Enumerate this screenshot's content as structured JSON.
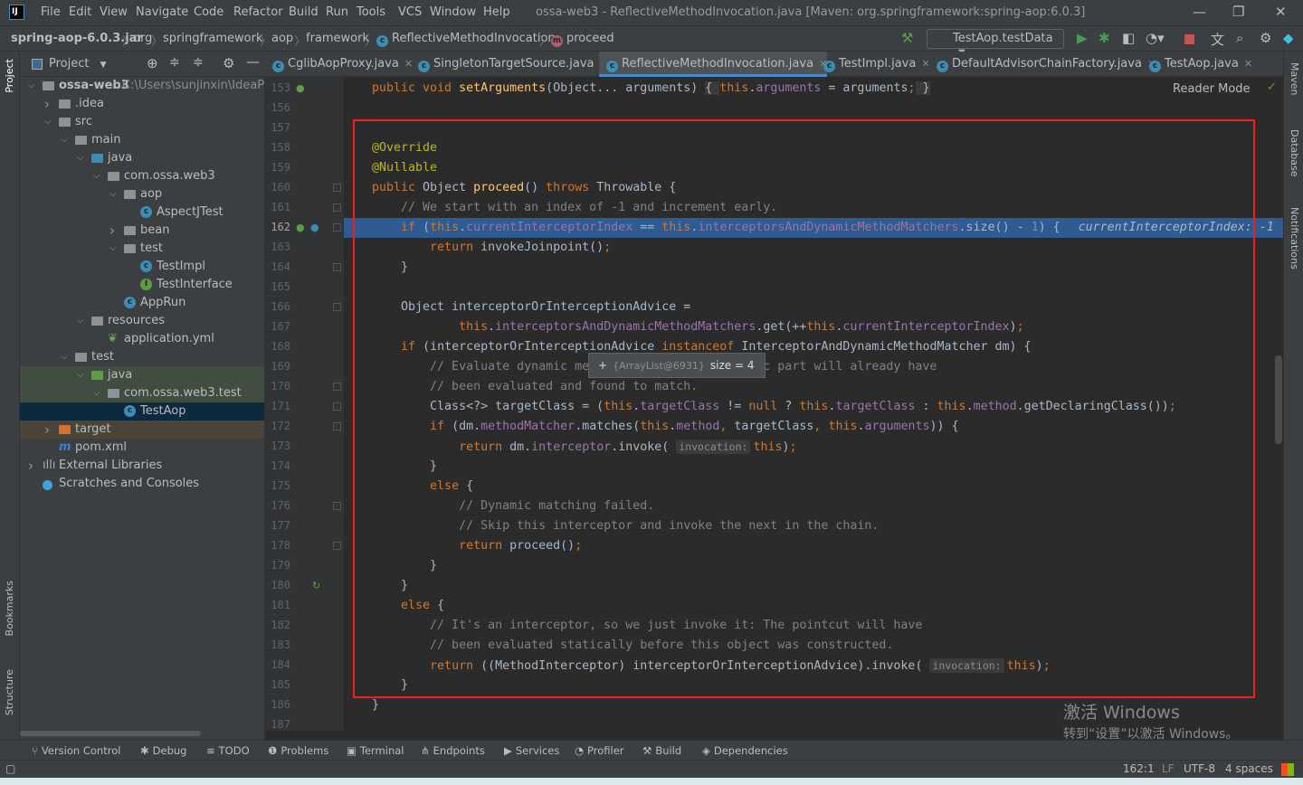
{
  "window": {
    "title": "ossa-web3 - ReflectiveMethodInvocation.java [Maven: org.springframework:spring-aop:6.0.3]",
    "logo": "IJ",
    "minimize": "—",
    "restore": "❐",
    "close": "✕"
  },
  "menu": [
    "File",
    "Edit",
    "View",
    "Navigate",
    "Code",
    "Refactor",
    "Build",
    "Run",
    "Tools",
    "VCS",
    "Window",
    "Help"
  ],
  "breadcrumb": [
    "spring-aop-6.0.3.jar",
    "org",
    "springframework",
    "aop",
    "framework",
    "ReflectiveMethodInvocation",
    "proceed"
  ],
  "toolbar": {
    "run_config": "TestAop.testData",
    "icons": [
      "build-hammer-icon",
      "run-icon",
      "debug-icon",
      "coverage-icon",
      "profile-icon",
      "stop-icon",
      "translate-icon",
      "search-icon",
      "settings-icon",
      "toolbox-icon"
    ]
  },
  "project_panel": {
    "title": "Project",
    "tree": [
      {
        "label": "ossa-web3",
        "path": "C:\\Users\\sunjinxin\\IdeaProj",
        "level": 0,
        "arrow": "open",
        "icon": "module"
      },
      {
        "label": ".idea",
        "level": 1,
        "arrow": "closed",
        "icon": "folder"
      },
      {
        "label": "src",
        "level": 1,
        "arrow": "open",
        "icon": "folder"
      },
      {
        "label": "main",
        "level": 2,
        "arrow": "open",
        "icon": "folder"
      },
      {
        "label": "java",
        "level": 3,
        "arrow": "open",
        "icon": "src-folder"
      },
      {
        "label": "com.ossa.web3",
        "level": 4,
        "arrow": "open",
        "icon": "package"
      },
      {
        "label": "aop",
        "level": 5,
        "arrow": "open",
        "icon": "package"
      },
      {
        "label": "AspectJTest",
        "level": 6,
        "icon": "class"
      },
      {
        "label": "bean",
        "level": 5,
        "arrow": "closed",
        "icon": "package"
      },
      {
        "label": "test",
        "level": 5,
        "arrow": "open",
        "icon": "package"
      },
      {
        "label": "TestImpl",
        "level": 6,
        "icon": "class"
      },
      {
        "label": "TestInterface",
        "level": 6,
        "icon": "interface"
      },
      {
        "label": "AppRun",
        "level": 5,
        "icon": "class"
      },
      {
        "label": "resources",
        "level": 3,
        "arrow": "open",
        "icon": "folder"
      },
      {
        "label": "application.yml",
        "level": 4,
        "icon": "yml"
      },
      {
        "label": "test",
        "level": 2,
        "arrow": "open",
        "icon": "folder"
      },
      {
        "label": "java",
        "level": 3,
        "arrow": "open",
        "icon": "test-folder",
        "state": "highlighted"
      },
      {
        "label": "com.ossa.web3.test",
        "level": 4,
        "arrow": "open",
        "icon": "package",
        "state": "highlighted"
      },
      {
        "label": "TestAop",
        "level": 5,
        "icon": "class",
        "state": "selected"
      },
      {
        "label": "target",
        "level": 1,
        "arrow": "closed",
        "icon": "excluded-folder",
        "state": "excluded"
      },
      {
        "label": "pom.xml",
        "level": 1,
        "icon": "maven"
      },
      {
        "label": "External Libraries",
        "level": 0,
        "arrow": "closed",
        "icon": "libraries"
      },
      {
        "label": "Scratches and Consoles",
        "level": 0,
        "icon": "scratches"
      }
    ]
  },
  "tabs": [
    {
      "label": "CglibAopProxy.java"
    },
    {
      "label": "SingletonTargetSource.java"
    },
    {
      "label": "ReflectiveMethodInvocation.java",
      "active": true
    },
    {
      "label": "TestImpl.java"
    },
    {
      "label": "DefaultAdvisorChainFactory.java"
    },
    {
      "label": "TestAop.java"
    }
  ],
  "editor": {
    "reader_mode": "Reader Mode",
    "current_line": 162,
    "lines": [
      {
        "n": 153,
        "t": [
          [
            "kw",
            "public void "
          ],
          [
            "fn",
            "setArguments"
          ],
          [
            "",
            "(Object... arguments) "
          ],
          [
            "hl",
            "{ "
          ],
          [
            "kw",
            "this"
          ],
          [
            "",
            "."
          ],
          [
            "fd",
            "arguments"
          ],
          [
            "",
            " = arguments"
          ],
          [
            "kw",
            ";"
          ],
          [
            "hl",
            " }"
          ]
        ]
      },
      {
        "n": 156,
        "t": []
      },
      {
        "n": 157,
        "t": []
      },
      {
        "n": 158,
        "t": [
          [
            "an",
            "@Override"
          ]
        ]
      },
      {
        "n": 159,
        "t": [
          [
            "an",
            "@Nullable"
          ]
        ]
      },
      {
        "n": 160,
        "t": [
          [
            "kw",
            "public "
          ],
          [
            "",
            "Object "
          ],
          [
            "fn",
            "proceed"
          ],
          [
            "",
            "() "
          ],
          [
            "kw",
            "throws "
          ],
          [
            "",
            "Throwable {"
          ]
        ]
      },
      {
        "n": 161,
        "t": [
          [
            "cm",
            "    // We start with an index of -1 and increment early."
          ]
        ]
      },
      {
        "n": 162,
        "t": [
          [
            "",
            "    "
          ],
          [
            "kw",
            "if "
          ],
          [
            "",
            "("
          ],
          [
            "kw",
            "this"
          ],
          [
            "",
            "."
          ],
          [
            "fd",
            "currentInterceptorIndex"
          ],
          [
            "",
            " == "
          ],
          [
            "kw",
            "this"
          ],
          [
            "",
            "."
          ],
          [
            "fd",
            "interceptorsAndDynamicMethodMatchers"
          ],
          [
            "",
            ".size() - "
          ],
          [
            "nm",
            "1"
          ],
          [
            "",
            ") {"
          ],
          [
            "ht2",
            "currentInterceptorIndex: -1"
          ]
        ]
      },
      {
        "n": 163,
        "t": [
          [
            "",
            "        "
          ],
          [
            "kw",
            "return "
          ],
          [
            "",
            "invokeJoinpoint()"
          ],
          [
            "kw",
            ";"
          ]
        ]
      },
      {
        "n": 164,
        "t": [
          [
            "",
            "    }"
          ]
        ]
      },
      {
        "n": 165,
        "t": []
      },
      {
        "n": 166,
        "t": [
          [
            "",
            "    Object interceptorOrInterceptionAdvice ="
          ]
        ]
      },
      {
        "n": 167,
        "t": [
          [
            "",
            "            "
          ],
          [
            "kw",
            "this"
          ],
          [
            "",
            "."
          ],
          [
            "fd",
            "interceptorsAndDynamicMethodMatchers"
          ],
          [
            "",
            ".get(++"
          ],
          [
            "kw",
            "this"
          ],
          [
            "",
            "."
          ],
          [
            "fd",
            "currentInterceptorIndex"
          ],
          [
            "",
            ")"
          ],
          [
            "kw",
            ";"
          ]
        ]
      },
      {
        "n": 168,
        "t": [
          [
            "",
            "    "
          ],
          [
            "kw",
            "if "
          ],
          [
            "",
            "(interceptorOrInterceptionAdvice "
          ],
          [
            "kw",
            "instanceof "
          ],
          [
            "",
            "InterceptorAndDynamicMethodMatcher dm) {"
          ]
        ]
      },
      {
        "n": 169,
        "t": [
          [
            "cm",
            "        // Evaluate dynamic method matcher here: static part will already have"
          ]
        ]
      },
      {
        "n": 170,
        "t": [
          [
            "cm",
            "        // been evaluated and found to match."
          ]
        ]
      },
      {
        "n": 171,
        "t": [
          [
            "",
            "        Class<?> targetClass = ("
          ],
          [
            "kw",
            "this"
          ],
          [
            "",
            "."
          ],
          [
            "fd",
            "targetClass"
          ],
          [
            "",
            " != "
          ],
          [
            "kw",
            "null"
          ],
          [
            "",
            " ? "
          ],
          [
            "kw",
            "this"
          ],
          [
            "",
            "."
          ],
          [
            "fd",
            "targetClass"
          ],
          [
            "",
            " : "
          ],
          [
            "kw",
            "this"
          ],
          [
            "",
            "."
          ],
          [
            "fd",
            "method"
          ],
          [
            "",
            ".getDeclaringClass())"
          ],
          [
            "kw",
            ";"
          ]
        ]
      },
      {
        "n": 172,
        "t": [
          [
            "",
            "        "
          ],
          [
            "kw",
            "if "
          ],
          [
            "",
            "(dm."
          ],
          [
            "fd",
            "methodMatcher"
          ],
          [
            "",
            ".matches("
          ],
          [
            "kw",
            "this"
          ],
          [
            "",
            "."
          ],
          [
            "fd",
            "method"
          ],
          [
            "kw",
            ", "
          ],
          [
            "",
            "targetClass"
          ],
          [
            "kw",
            ", "
          ],
          [
            "kw",
            "this"
          ],
          [
            "",
            "."
          ],
          [
            "fd",
            "arguments"
          ],
          [
            "",
            ")) {"
          ]
        ]
      },
      {
        "n": 173,
        "t": [
          [
            "",
            "            "
          ],
          [
            "kw",
            "return "
          ],
          [
            "",
            "dm."
          ],
          [
            "fd",
            "interceptor"
          ],
          [
            "",
            ".invoke( "
          ],
          [
            "ht",
            "invocation:"
          ],
          [
            "kw",
            "this"
          ],
          [
            "",
            ")"
          ],
          [
            "kw",
            ";"
          ]
        ]
      },
      {
        "n": 174,
        "t": [
          [
            "",
            "        }"
          ]
        ]
      },
      {
        "n": 175,
        "t": [
          [
            "",
            "        "
          ],
          [
            "kw",
            "else "
          ],
          [
            "",
            "{"
          ]
        ]
      },
      {
        "n": 176,
        "t": [
          [
            "cm",
            "            // Dynamic matching failed."
          ]
        ]
      },
      {
        "n": 177,
        "t": [
          [
            "cm",
            "            // Skip this interceptor and invoke the next in the chain."
          ]
        ]
      },
      {
        "n": 178,
        "t": [
          [
            "",
            "            "
          ],
          [
            "kw",
            "return "
          ],
          [
            "",
            "proceed()"
          ],
          [
            "kw",
            ";"
          ]
        ]
      },
      {
        "n": 179,
        "t": [
          [
            "",
            "        }"
          ]
        ]
      },
      {
        "n": 180,
        "t": [
          [
            "",
            "    }"
          ]
        ]
      },
      {
        "n": 181,
        "t": [
          [
            "",
            "    "
          ],
          [
            "kw",
            "else "
          ],
          [
            "",
            "{"
          ]
        ]
      },
      {
        "n": 182,
        "t": [
          [
            "cm",
            "        // It's an interceptor, so we just invoke it: The pointcut will have"
          ]
        ]
      },
      {
        "n": 183,
        "t": [
          [
            "cm",
            "        // been evaluated statically before this object was constructed."
          ]
        ]
      },
      {
        "n": 184,
        "t": [
          [
            "",
            "        "
          ],
          [
            "kw",
            "return "
          ],
          [
            "",
            "((MethodInterceptor) interceptorOrInterceptionAdvice).invoke( "
          ],
          [
            "ht",
            "invocation:"
          ],
          [
            "kw",
            "this"
          ],
          [
            "",
            ")"
          ],
          [
            "kw",
            ";"
          ]
        ]
      },
      {
        "n": 185,
        "t": [
          [
            "",
            "    }"
          ]
        ]
      },
      {
        "n": 186,
        "t": [
          [
            "",
            "}"
          ]
        ]
      },
      {
        "n": 187,
        "t": []
      }
    ]
  },
  "tooltip": {
    "expand": "+",
    "object": "{ArrayList@6931}",
    "value": "size = 4"
  },
  "highlight_color": "#f21d1d",
  "left_stripe": [
    "Project",
    "Bookmarks",
    "Structure"
  ],
  "right_stripe": [
    "Maven",
    "Database",
    "Notifications"
  ],
  "bottom_tools": [
    "Version Control",
    "Debug",
    "TODO",
    "Problems",
    "Terminal",
    "Endpoints",
    "Services",
    "Profiler",
    "Build",
    "Dependencies"
  ],
  "status": {
    "position": "162:1",
    "line_sep": "LF",
    "encoding": "UTF-8",
    "indent": "4 spaces"
  },
  "watermark": {
    "line1": "激活 Windows",
    "line2": "转到“设置”以激活 Windows。"
  }
}
